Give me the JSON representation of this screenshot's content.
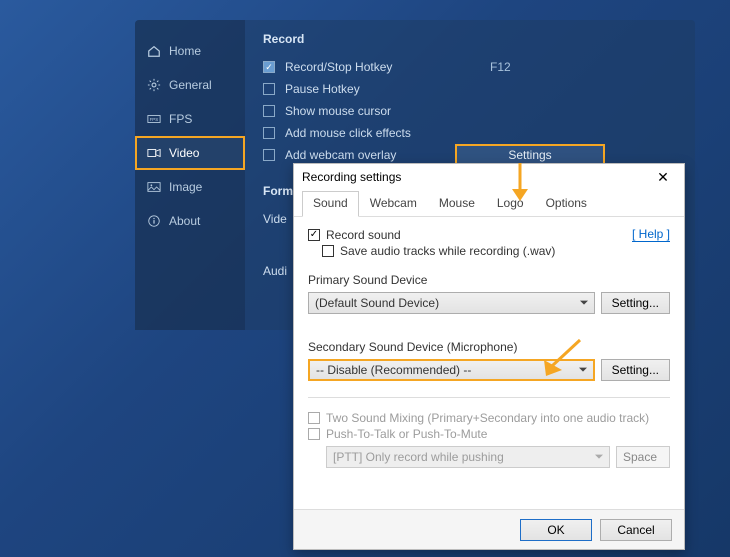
{
  "bg": {
    "sidebar": [
      {
        "label": "Home"
      },
      {
        "label": "General"
      },
      {
        "label": "FPS"
      },
      {
        "label": "Video"
      },
      {
        "label": "Image"
      },
      {
        "label": "About"
      }
    ],
    "record_title": "Record",
    "rows": {
      "record_stop": "Record/Stop Hotkey",
      "record_stop_val": "F12",
      "pause": "Pause Hotkey",
      "pause_val": "",
      "mouse_cursor": "Show mouse cursor",
      "mouse_fx": "Add mouse click effects",
      "webcam": "Add webcam overlay",
      "settings_btn": "Settings"
    },
    "format_title": "Form",
    "video_label": "Vide",
    "audio_label": "Audi"
  },
  "dialog": {
    "title": "Recording settings",
    "tabs": [
      "Sound",
      "Webcam",
      "Mouse",
      "Logo",
      "Options"
    ],
    "help": "[ Help ]",
    "record_sound": "Record sound",
    "save_tracks": "Save audio tracks while recording (.wav)",
    "primary_label": "Primary Sound Device",
    "primary_value": "(Default Sound Device)",
    "setting_btn": "Setting...",
    "secondary_label": "Secondary Sound Device (Microphone)",
    "secondary_value": "-- Disable (Recommended) --",
    "two_mix": "Two Sound Mixing (Primary+Secondary into one audio track)",
    "ptt": "Push-To-Talk or Push-To-Mute",
    "ptt_mode": "[PTT] Only record while pushing",
    "ptt_key": "Space",
    "ok": "OK",
    "cancel": "Cancel"
  }
}
